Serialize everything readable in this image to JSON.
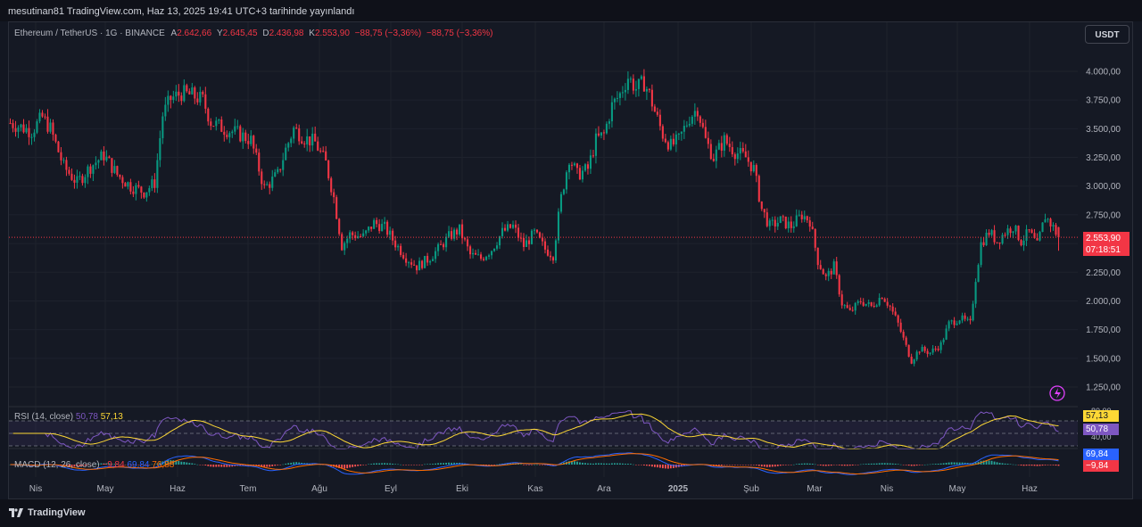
{
  "header": {
    "publisher_line": "mesutinan81 TradingView.com, Haz 13, 2025 19:41 UTC+3 tarihinde yayınlandı"
  },
  "legend": {
    "symbol": "Ethereum / TetherUS · 1G · BINANCE",
    "open_label": "A",
    "open_value": "2.642,66",
    "high_label": "Y",
    "high_value": "2.645,45",
    "low_label": "D",
    "low_value": "2.436,98",
    "close_label": "K",
    "close_value": "2.553,90",
    "change": "−88,75 (−3,36%)",
    "change2": "−88,75 (−3,36%)"
  },
  "currency_button": "USDT",
  "price_badge": {
    "price": "2.553,90",
    "countdown": "07:18:51"
  },
  "rsi": {
    "label": "RSI (14, close)",
    "rsi_value": "50,78",
    "ma_value": "57,13",
    "upper_axis": "80,00",
    "lower_axis": "40,00"
  },
  "macd": {
    "label": "MACD (12, 26, close)",
    "histogram_value": "−9,84",
    "macd_value": "69,84",
    "signal_value": "76,88",
    "axis_badge_top": "69,84",
    "axis_badge_bottom": "−9,84"
  },
  "brand": "TradingView",
  "colors": {
    "up": "#089981",
    "down": "#f23645",
    "background": "#131722",
    "rsi_line": "#7e57c2",
    "rsi_ma": "#fdd835",
    "macd_line": "#2962ff",
    "signal_line": "#ff6d00",
    "price_line": "#f23645"
  },
  "chart_data": {
    "type": "candlestick",
    "symbol": "ETHUSDT",
    "interval": "1D",
    "y_axis_ticks": [
      "4.000,00",
      "3.750,00",
      "3.500,00",
      "3.250,00",
      "3.000,00",
      "2.750,00",
      "2.500,00",
      "2.250,00",
      "2.000,00",
      "1.750,00",
      "1.500,00",
      "1.250,00"
    ],
    "y_tick_values": [
      4000,
      3750,
      3500,
      3250,
      3000,
      2750,
      2500,
      2250,
      2000,
      1750,
      1500,
      1250
    ],
    "ylim": [
      1250,
      4000
    ],
    "x_axis_ticks": [
      "Nis",
      "May",
      "Haz",
      "Tem",
      "Ağu",
      "Eyl",
      "Eki",
      "Kas",
      "Ara",
      "2025",
      "Şub",
      "Mar",
      "Nis",
      "May",
      "Haz"
    ],
    "current_price": 2553.9,
    "close_path": [
      {
        "t": 0,
        "c": 3550
      },
      {
        "t": 8,
        "c": 3480
      },
      {
        "t": 12,
        "c": 3600
      },
      {
        "t": 15,
        "c": 3500
      },
      {
        "t": 20,
        "c": 3170
      },
      {
        "t": 25,
        "c": 3030
      },
      {
        "t": 30,
        "c": 3170
      },
      {
        "t": 35,
        "c": 3270
      },
      {
        "t": 40,
        "c": 3100
      },
      {
        "t": 45,
        "c": 3000
      },
      {
        "t": 50,
        "c": 2950
      },
      {
        "t": 54,
        "c": 3030
      },
      {
        "t": 57,
        "c": 3620
      },
      {
        "t": 60,
        "c": 3760
      },
      {
        "t": 64,
        "c": 3810
      },
      {
        "t": 68,
        "c": 3790
      },
      {
        "t": 72,
        "c": 3750
      },
      {
        "t": 75,
        "c": 3560
      },
      {
        "t": 80,
        "c": 3500
      },
      {
        "t": 85,
        "c": 3460
      },
      {
        "t": 90,
        "c": 3400
      },
      {
        "t": 95,
        "c": 2980
      },
      {
        "t": 100,
        "c": 3100
      },
      {
        "t": 103,
        "c": 3320
      },
      {
        "t": 106,
        "c": 3500
      },
      {
        "t": 110,
        "c": 3420
      },
      {
        "t": 114,
        "c": 3380
      },
      {
        "t": 118,
        "c": 3200
      },
      {
        "t": 121,
        "c": 2900
      },
      {
        "t": 124,
        "c": 2480
      },
      {
        "t": 127,
        "c": 2580
      },
      {
        "t": 132,
        "c": 2560
      },
      {
        "t": 136,
        "c": 2680
      },
      {
        "t": 140,
        "c": 2640
      },
      {
        "t": 144,
        "c": 2500
      },
      {
        "t": 148,
        "c": 2380
      },
      {
        "t": 152,
        "c": 2300
      },
      {
        "t": 156,
        "c": 2360
      },
      {
        "t": 160,
        "c": 2450
      },
      {
        "t": 164,
        "c": 2560
      },
      {
        "t": 168,
        "c": 2620
      },
      {
        "t": 172,
        "c": 2400
      },
      {
        "t": 176,
        "c": 2370
      },
      {
        "t": 180,
        "c": 2450
      },
      {
        "t": 184,
        "c": 2600
      },
      {
        "t": 188,
        "c": 2650
      },
      {
        "t": 192,
        "c": 2480
      },
      {
        "t": 196,
        "c": 2590
      },
      {
        "t": 200,
        "c": 2450
      },
      {
        "t": 203,
        "c": 2400
      },
      {
        "t": 206,
        "c": 2900
      },
      {
        "t": 209,
        "c": 3250
      },
      {
        "t": 212,
        "c": 3100
      },
      {
        "t": 216,
        "c": 3150
      },
      {
        "t": 219,
        "c": 3400
      },
      {
        "t": 222,
        "c": 3450
      },
      {
        "t": 225,
        "c": 3700
      },
      {
        "t": 228,
        "c": 3800
      },
      {
        "t": 231,
        "c": 3950
      },
      {
        "t": 234,
        "c": 3850
      },
      {
        "t": 237,
        "c": 3900
      },
      {
        "t": 239,
        "c": 3800
      },
      {
        "t": 241,
        "c": 3650
      },
      {
        "t": 244,
        "c": 3450
      },
      {
        "t": 247,
        "c": 3350
      },
      {
        "t": 250,
        "c": 3400
      },
      {
        "t": 254,
        "c": 3600
      },
      {
        "t": 257,
        "c": 3680
      },
      {
        "t": 260,
        "c": 3400
      },
      {
        "t": 263,
        "c": 3250
      },
      {
        "t": 267,
        "c": 3400
      },
      {
        "t": 271,
        "c": 3300
      },
      {
        "t": 275,
        "c": 3250
      },
      {
        "t": 278,
        "c": 3150
      },
      {
        "t": 281,
        "c": 2800
      },
      {
        "t": 284,
        "c": 2650
      },
      {
        "t": 288,
        "c": 2700
      },
      {
        "t": 292,
        "c": 2650
      },
      {
        "t": 296,
        "c": 2750
      },
      {
        "t": 299,
        "c": 2700
      },
      {
        "t": 302,
        "c": 2350
      },
      {
        "t": 305,
        "c": 2200
      },
      {
        "t": 308,
        "c": 2300
      },
      {
        "t": 311,
        "c": 1980
      },
      {
        "t": 314,
        "c": 1900
      },
      {
        "t": 318,
        "c": 2000
      },
      {
        "t": 322,
        "c": 1950
      },
      {
        "t": 326,
        "c": 2050
      },
      {
        "t": 329,
        "c": 1950
      },
      {
        "t": 332,
        "c": 1800
      },
      {
        "t": 335,
        "c": 1600
      },
      {
        "t": 337,
        "c": 1480
      },
      {
        "t": 340,
        "c": 1580
      },
      {
        "t": 344,
        "c": 1550
      },
      {
        "t": 348,
        "c": 1620
      },
      {
        "t": 351,
        "c": 1800
      },
      {
        "t": 355,
        "c": 1850
      },
      {
        "t": 359,
        "c": 1800
      },
      {
        "t": 361,
        "c": 2200
      },
      {
        "t": 363,
        "c": 2500
      },
      {
        "t": 366,
        "c": 2600
      },
      {
        "t": 369,
        "c": 2520
      },
      {
        "t": 372,
        "c": 2600
      },
      {
        "t": 375,
        "c": 2650
      },
      {
        "t": 378,
        "c": 2520
      },
      {
        "t": 381,
        "c": 2600
      },
      {
        "t": 384,
        "c": 2480
      },
      {
        "t": 387,
        "c": 2740
      },
      {
        "t": 390,
        "c": 2640
      },
      {
        "t": 392,
        "c": 2554
      }
    ],
    "rsi_axis": [
      "80,00",
      "40,00"
    ],
    "rsi_current": 50.78,
    "rsi_ma_current": 57.13,
    "macd_current": 69.84,
    "macd_signal_current": 76.88,
    "macd_histogram_current": -9.84
  }
}
